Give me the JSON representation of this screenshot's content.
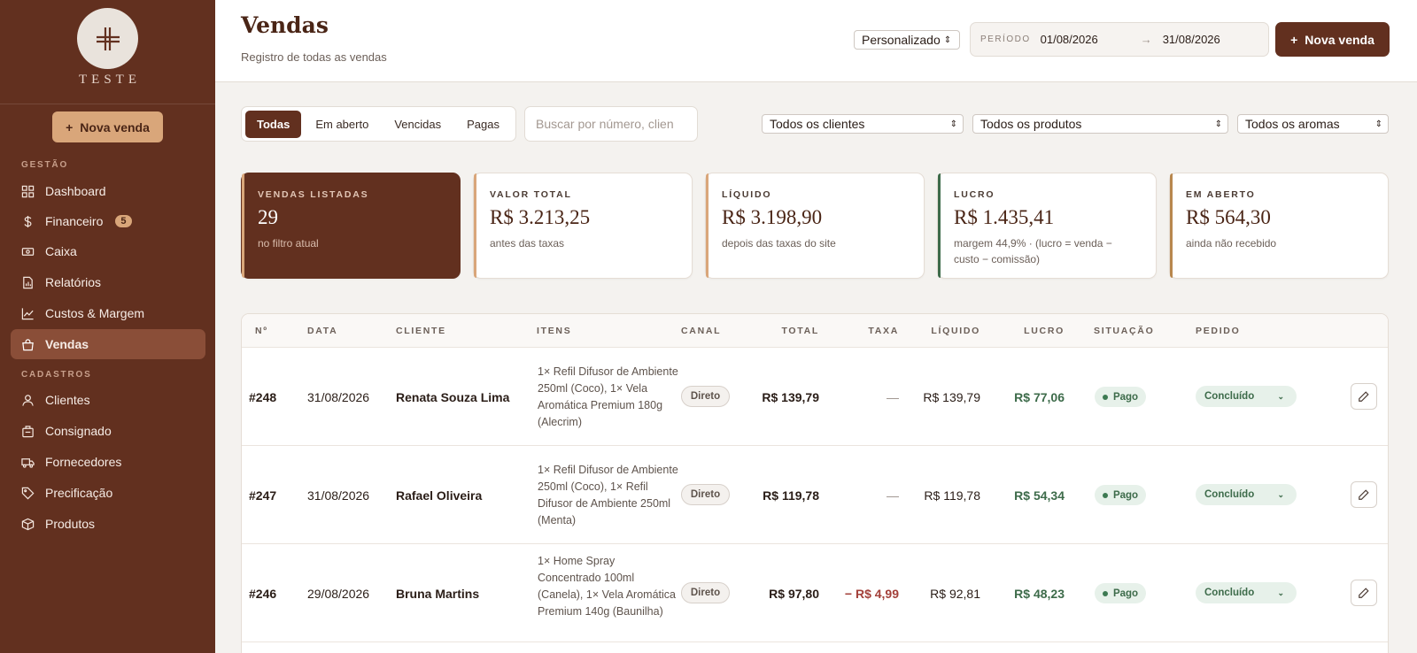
{
  "brand": {
    "name": "TESTE"
  },
  "sidebar": {
    "cta_label": "Nova venda",
    "sections": {
      "gestao": "GESTÃO",
      "cadastros": "CADASTROS"
    },
    "items": [
      {
        "label": "Dashboard",
        "icon": "grid-icon"
      },
      {
        "label": "Financeiro",
        "icon": "dollar-icon",
        "badge": "5"
      },
      {
        "label": "Caixa",
        "icon": "cash-icon"
      },
      {
        "label": "Relatórios",
        "icon": "report-icon"
      },
      {
        "label": "Custos & Margem",
        "icon": "chart-line-icon"
      },
      {
        "label": "Vendas",
        "icon": "bag-icon",
        "active": true
      },
      {
        "label": "Clientes",
        "icon": "user-icon"
      },
      {
        "label": "Consignado",
        "icon": "briefcase-icon"
      },
      {
        "label": "Fornecedores",
        "icon": "truck-icon"
      },
      {
        "label": "Precificação",
        "icon": "tag-icon"
      },
      {
        "label": "Produtos",
        "icon": "box-icon"
      }
    ]
  },
  "header": {
    "title": "Vendas",
    "subtitle": "Registro de todas as vendas",
    "period_select": "Personalizado",
    "period_label": "PERÍODO",
    "date_from": "01/08/2026",
    "date_to": "31/08/2026",
    "new_sale": "Nova venda"
  },
  "filters": {
    "tabs": [
      "Todas",
      "Em aberto",
      "Vencidas",
      "Pagas"
    ],
    "search_placeholder": "Buscar por número, clien",
    "clients": "Todos os clientes",
    "products": "Todos os produtos",
    "aromas": "Todos os aromas"
  },
  "stats": [
    {
      "key": "VENDAS LISTADAS",
      "value": "29",
      "sub": "no filtro atual"
    },
    {
      "key": "VALOR TOTAL",
      "value": "R$ 3.213,25",
      "sub": "antes das taxas"
    },
    {
      "key": "LÍQUIDO",
      "value": "R$ 3.198,90",
      "sub": "depois das taxas do site"
    },
    {
      "key": "LUCRO",
      "value": "R$ 1.435,41",
      "sub": "margem 44,9% · (lucro = venda − custo − comissão)"
    },
    {
      "key": "EM ABERTO",
      "value": "R$ 564,30",
      "sub": "ainda não recebido"
    }
  ],
  "colors": {
    "brand": "#62301f",
    "accent_tan": "#d9a67a",
    "accent_green": "#3d6b4a",
    "accent_gold": "#b8874e",
    "negative": "#a3403a"
  },
  "table": {
    "headers": [
      "Nº",
      "DATA",
      "CLIENTE",
      "ITENS",
      "CANAL",
      "TOTAL",
      "TAXA",
      "LÍQUIDO",
      "LUCRO",
      "SITUAÇÃO",
      "PEDIDO"
    ],
    "rows": [
      {
        "num": "#248",
        "date": "31/08/2026",
        "client": "Renata Souza Lima",
        "items": "1× Refil Difusor de Ambiente 250ml (Coco), 1× Vela Aromática Premium 180g (Alecrim)",
        "channel": "Direto",
        "total": "R$ 139,79",
        "fee": "—",
        "net": "R$ 139,79",
        "profit": "R$ 77,06",
        "status": "Pago",
        "order": "Concluído"
      },
      {
        "num": "#247",
        "date": "31/08/2026",
        "client": "Rafael Oliveira",
        "items": "1× Refil Difusor de Ambiente 250ml (Coco), 1× Refil Difusor de Ambiente 250ml (Menta)",
        "channel": "Direto",
        "total": "R$ 119,78",
        "fee": "—",
        "net": "R$ 119,78",
        "profit": "R$ 54,34",
        "status": "Pago",
        "order": "Concluído"
      },
      {
        "num": "#246",
        "date": "29/08/2026",
        "client": "Bruna Martins",
        "items": "1× Home Spray Concentrado 100ml (Canela), 1× Vela Aromática Premium 140g (Baunilha)",
        "channel": "Direto",
        "total": "R$ 97,80",
        "fee": "− R$ 4,99",
        "net": "R$ 92,81",
        "profit": "R$ 48,23",
        "status": "Pago",
        "order": "Concluído"
      }
    ]
  }
}
